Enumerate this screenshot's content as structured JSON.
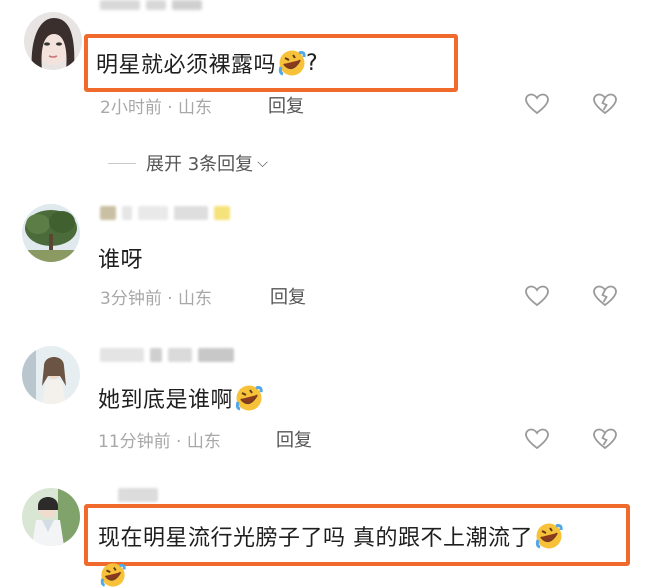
{
  "comments": [
    {
      "text": "明星就必须裸露吗",
      "suffix": "?",
      "emoji": "rofl-emoji",
      "meta": "2小时前 · 山东",
      "reply_label": "回复",
      "highlighted": true
    },
    {
      "text": "谁呀",
      "meta": "3分钟前 · 山东",
      "reply_label": "回复",
      "highlighted": false
    },
    {
      "text": "她到底是谁啊",
      "emoji": "rofl-emoji",
      "meta": "11分钟前 · 山东",
      "reply_label": "回复",
      "highlighted": false
    },
    {
      "text": "现在明星流行光膀子了吗 真的跟不上潮流了",
      "emoji": "rofl-emoji",
      "highlighted": true
    }
  ],
  "expand_replies": {
    "label": "展开 3条回复",
    "icon": "chevron-down-icon"
  },
  "icons": {
    "like": "heart-outline-icon",
    "dislike": "broken-heart-icon"
  },
  "colors": {
    "highlight_border": "#f06a2b",
    "meta_text": "#a8a8a8",
    "icon_stroke": "#9a9a9a"
  }
}
